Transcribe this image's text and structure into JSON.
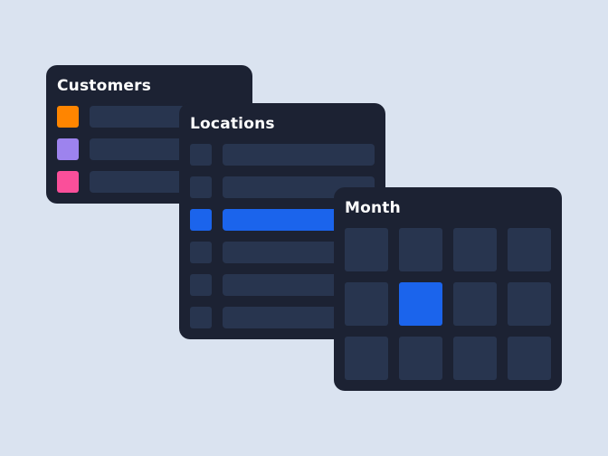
{
  "customers": {
    "title": "Customers",
    "rows": [
      {
        "color": "#ff8500",
        "icon": "orange-swatch"
      },
      {
        "color": "#9d83ee",
        "icon": "purple-swatch"
      },
      {
        "color": "#fa4f9a",
        "icon": "pink-swatch"
      }
    ]
  },
  "locations": {
    "title": "Locations",
    "row_count": 6,
    "selected_index": 2
  },
  "month": {
    "title": "Month",
    "columns": 4,
    "rows": 3,
    "selected_index": 5
  },
  "colors": {
    "background": "#dae3f0",
    "card": "#1c2233",
    "placeholder": "#28354f",
    "accent": "#1b64ec"
  }
}
